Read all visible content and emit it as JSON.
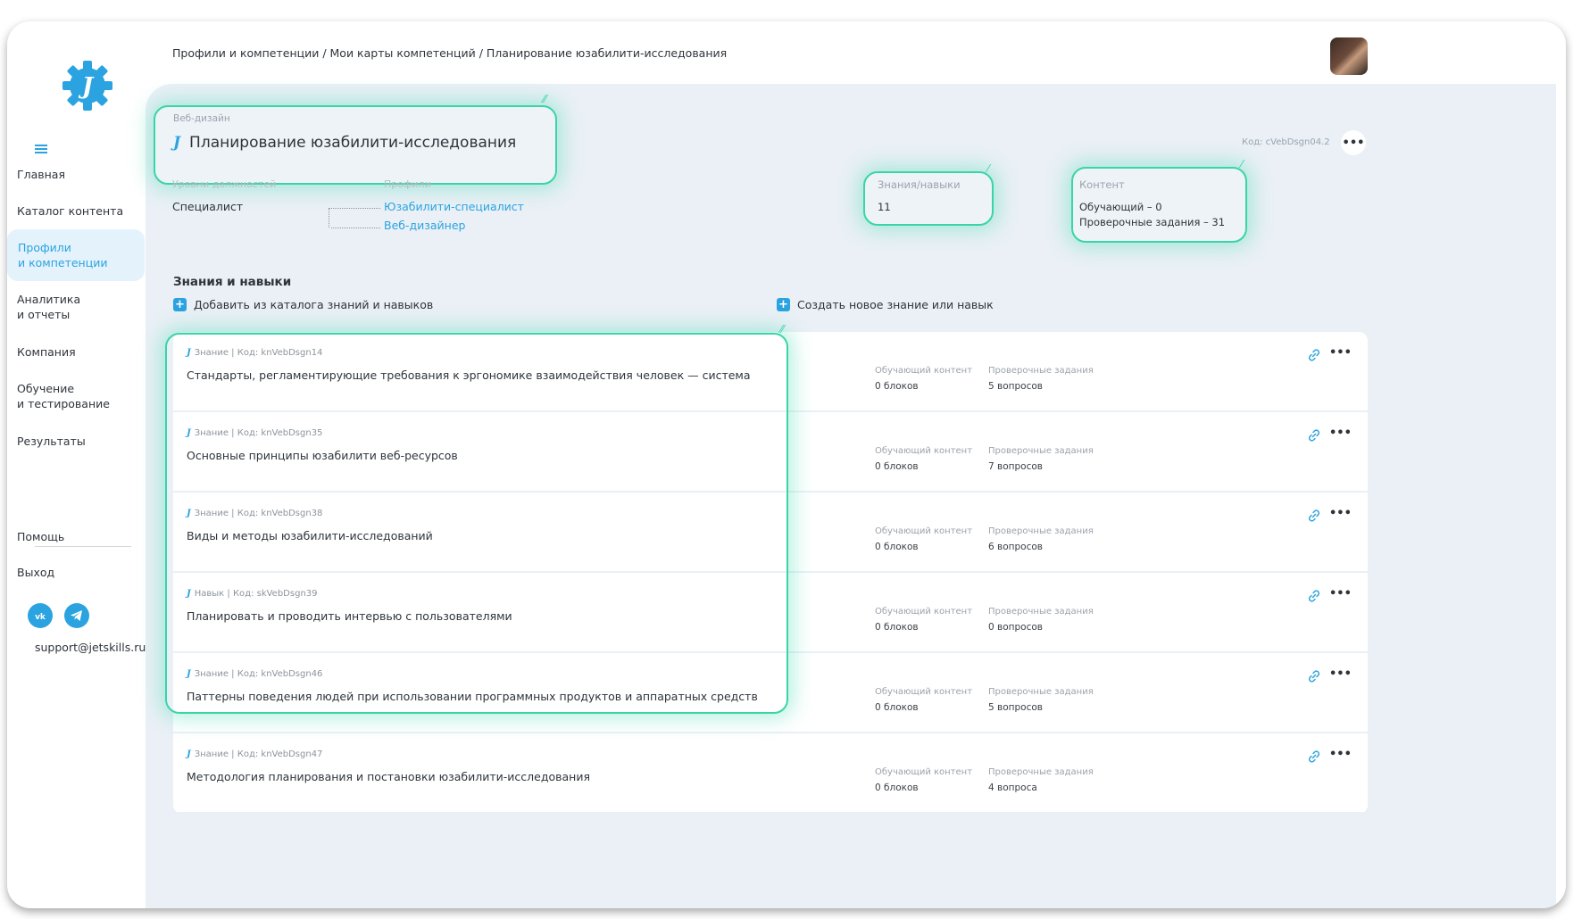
{
  "breadcrumb": "Профили и компетенции / Мои карты компетенций / Планирование юзабилити-исследования",
  "sidebar": {
    "items": [
      {
        "label": "Главная"
      },
      {
        "label": "Каталог контента"
      },
      {
        "label": "Профили\nи компетенции"
      },
      {
        "label": "Аналитика\nи отчеты"
      },
      {
        "label": "Компания"
      },
      {
        "label": "Обучение\nи тестирование"
      },
      {
        "label": "Результаты"
      },
      {
        "label": "Помощь"
      },
      {
        "label": "Выход"
      }
    ],
    "support_email": "support@jetskills.ru"
  },
  "competency": {
    "category": "Веб-дизайн",
    "title": "Планирование юзабилити-исследования",
    "code": "Код: cVebDsgn04.2",
    "levels_label": "Уровни должностей",
    "level_value": "Специалист",
    "profiles_label": "Профили",
    "profiles": [
      "Юзабилити-специалист",
      "Веб-дизайнер"
    ],
    "knowledge_label": "Знания/навыки",
    "knowledge_value": "11",
    "content_label": "Контент",
    "content_learning": "Обучающий – 0",
    "content_tests": "Проверочные задания – 31"
  },
  "section": {
    "title": "Знания и навыки",
    "add_from_catalog": "Добавить из каталога знаний и навыков",
    "create_new": "Создать новое знание или навык"
  },
  "column_labels": {
    "learning": "Обучающий контент",
    "tests": "Проверочные задания"
  },
  "rows": [
    {
      "meta": "Знание | Код: knVebDsgn14",
      "title": "Стандарты, регламентирующие требования к эргономике взаимодействия человек — система",
      "learning": "0 блоков",
      "tests": "5 вопросов"
    },
    {
      "meta": "Знание | Код: knVebDsgn35",
      "title": "Основные принципы юзабилити веб-ресурсов",
      "learning": "0 блоков",
      "tests": "7 вопросов"
    },
    {
      "meta": "Знание | Код: knVebDsgn38",
      "title": "Виды и методы юзабилити-исследований",
      "learning": "0 блоков",
      "tests": "6 вопросов"
    },
    {
      "meta": "Навык | Код: skVebDsgn39",
      "title": "Планировать и проводить интервью с пользователями",
      "learning": "0 блоков",
      "tests": "0 вопросов"
    },
    {
      "meta": "Знание | Код: knVebDsgn46",
      "title": "Паттерны поведения людей при использовании программных продуктов и аппаратных средств",
      "learning": "0 блоков",
      "tests": "5 вопросов"
    },
    {
      "meta": "Знание | Код: knVebDsgn47",
      "title": "Методология планирования и постановки юзабилити-исследования",
      "learning": "0 блоков",
      "tests": "4 вопроса"
    }
  ],
  "colors": {
    "accent": "#2aa3e0",
    "highlight": "#39d5a6",
    "panel": "#eaf0f6"
  }
}
